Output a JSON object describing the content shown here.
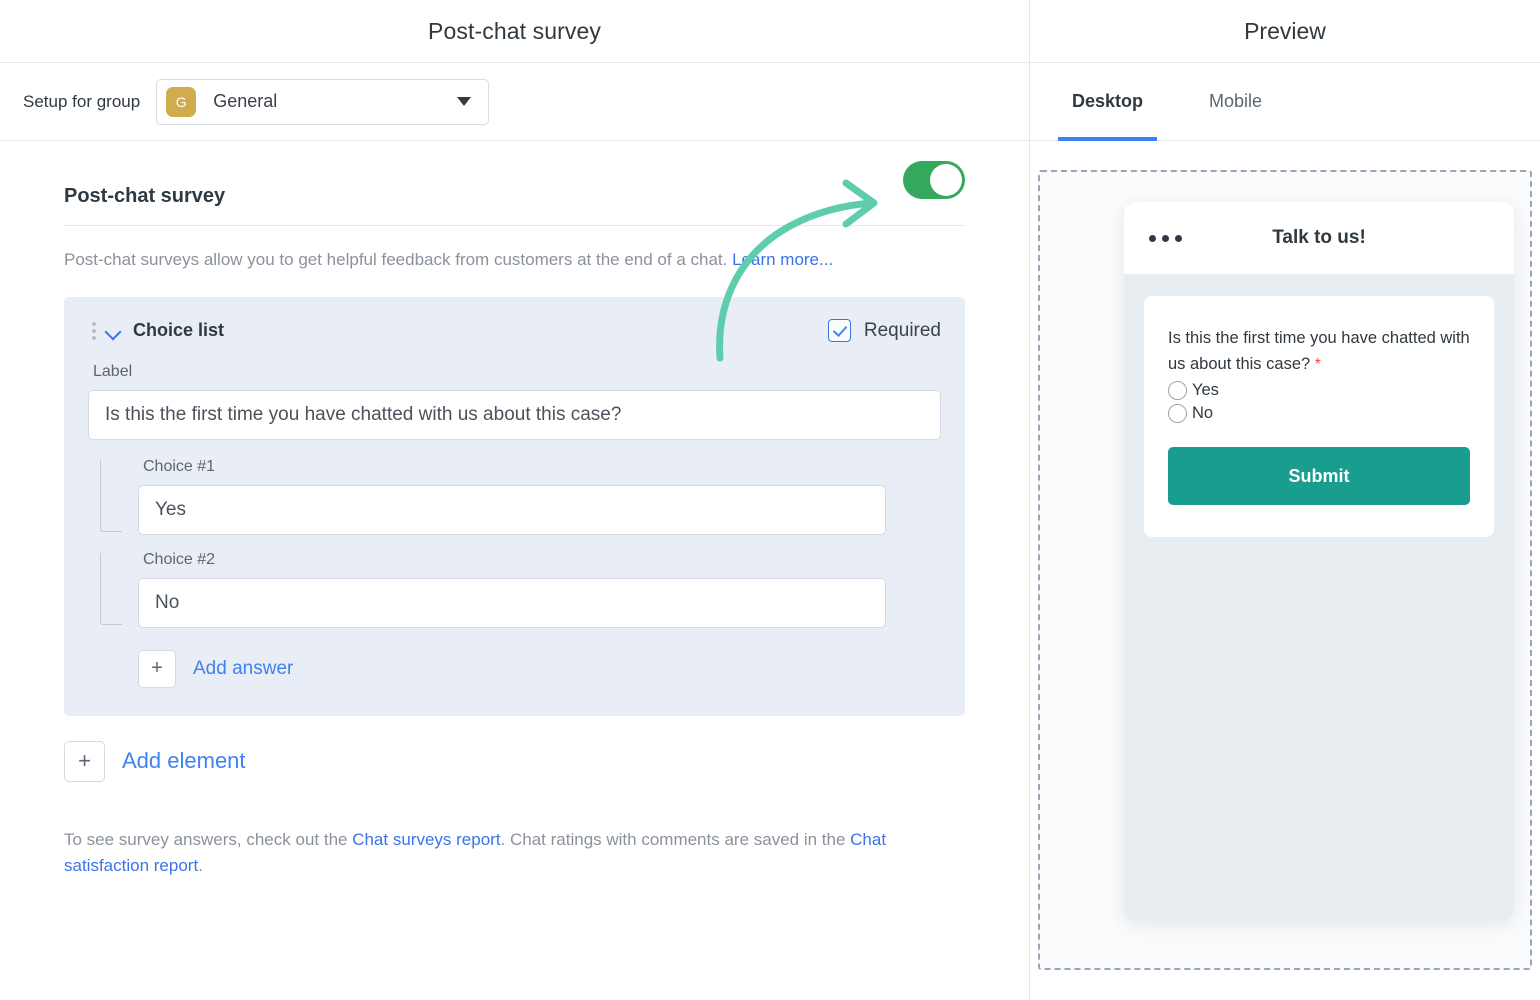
{
  "left": {
    "title": "Post-chat survey",
    "group_bar": {
      "label": "Setup for group",
      "avatar_initial": "G",
      "selected_group": "General",
      "avatar_color": "#cfad4e"
    },
    "section": {
      "heading": "Post-chat survey",
      "description_before": "Post-chat surveys allow you to get helpful feedback from customers at the end of a chat. ",
      "learn_more": "Learn more...",
      "toggle_state": "on",
      "toggle_color": "#34a85c"
    },
    "choice_card": {
      "title": "Choice list",
      "required_label": "Required",
      "required_checked": true,
      "label_caption": "Label",
      "label_value": "Is this the first time you have chatted with us about this case?",
      "choices": [
        {
          "caption": "Choice #1",
          "value": "Yes"
        },
        {
          "caption": "Choice #2",
          "value": "No"
        }
      ],
      "add_answer_label": "Add answer",
      "add_answer_icon": "plus-icon"
    },
    "add_element_label": "Add element",
    "add_element_icon": "plus-icon",
    "footnote": {
      "part1": "To see survey answers, check out the ",
      "link1": "Chat surveys report",
      "part2": ". Chat ratings with comments are saved in the ",
      "link2": "Chat satisfaction report",
      "part3": "."
    },
    "annotation_arrow": {
      "name": "curved-arrow-annotation",
      "color": "#5ecdae"
    }
  },
  "right": {
    "title": "Preview",
    "tabs": [
      {
        "label": "Desktop",
        "active": true
      },
      {
        "label": "Mobile",
        "active": false
      }
    ],
    "active_tab_color": "#3b82f6",
    "widget": {
      "menu_icon": "ellipsis-icon",
      "header_title": "Talk to us!",
      "question": "Is this the first time you have chatted with us about this case?",
      "required_marker": "*",
      "options": [
        "Yes",
        "No"
      ],
      "submit_label": "Submit",
      "submit_color": "#199d8e"
    }
  }
}
